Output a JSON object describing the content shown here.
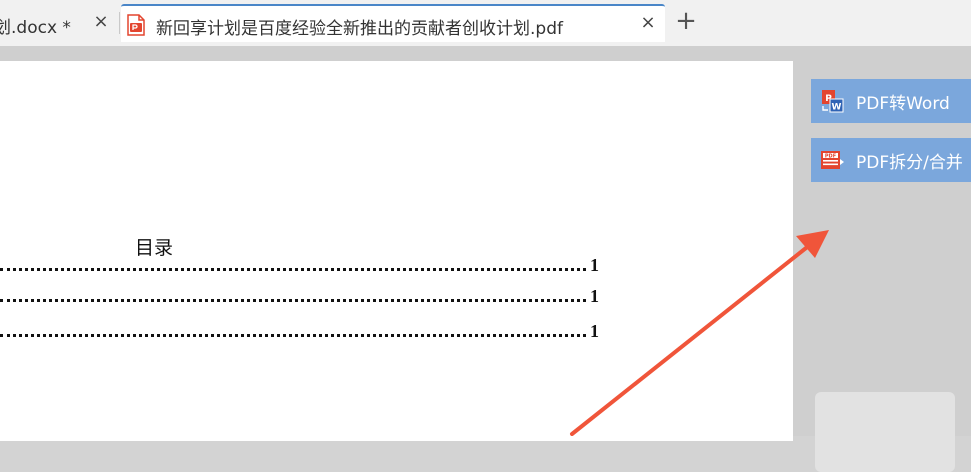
{
  "tabs": [
    {
      "label": "划.docx *",
      "close": "×"
    },
    {
      "label": "新回享计划是百度经验全新推出的贡献者创收计划.pdf",
      "close": "×"
    }
  ],
  "add_tab": "+",
  "document": {
    "toc_title": "目录",
    "toc_lines": [
      {
        "page": "1"
      },
      {
        "page": "1"
      },
      {
        "page": "1"
      }
    ]
  },
  "side_panel": {
    "pdf_to_word": "PDF转Word",
    "pdf_split_merge": "PDF拆分/合并"
  },
  "icons": {
    "pdf_file": "pdf-file-icon",
    "pdf_to_word": "pdf-to-word-icon",
    "pdf_split": "pdf-split-icon"
  },
  "colors": {
    "tab_accent": "#4a86c8",
    "side_button": "#7ba7dc",
    "arrow": "#f0553a",
    "pdf_icon": "#e3452f"
  }
}
